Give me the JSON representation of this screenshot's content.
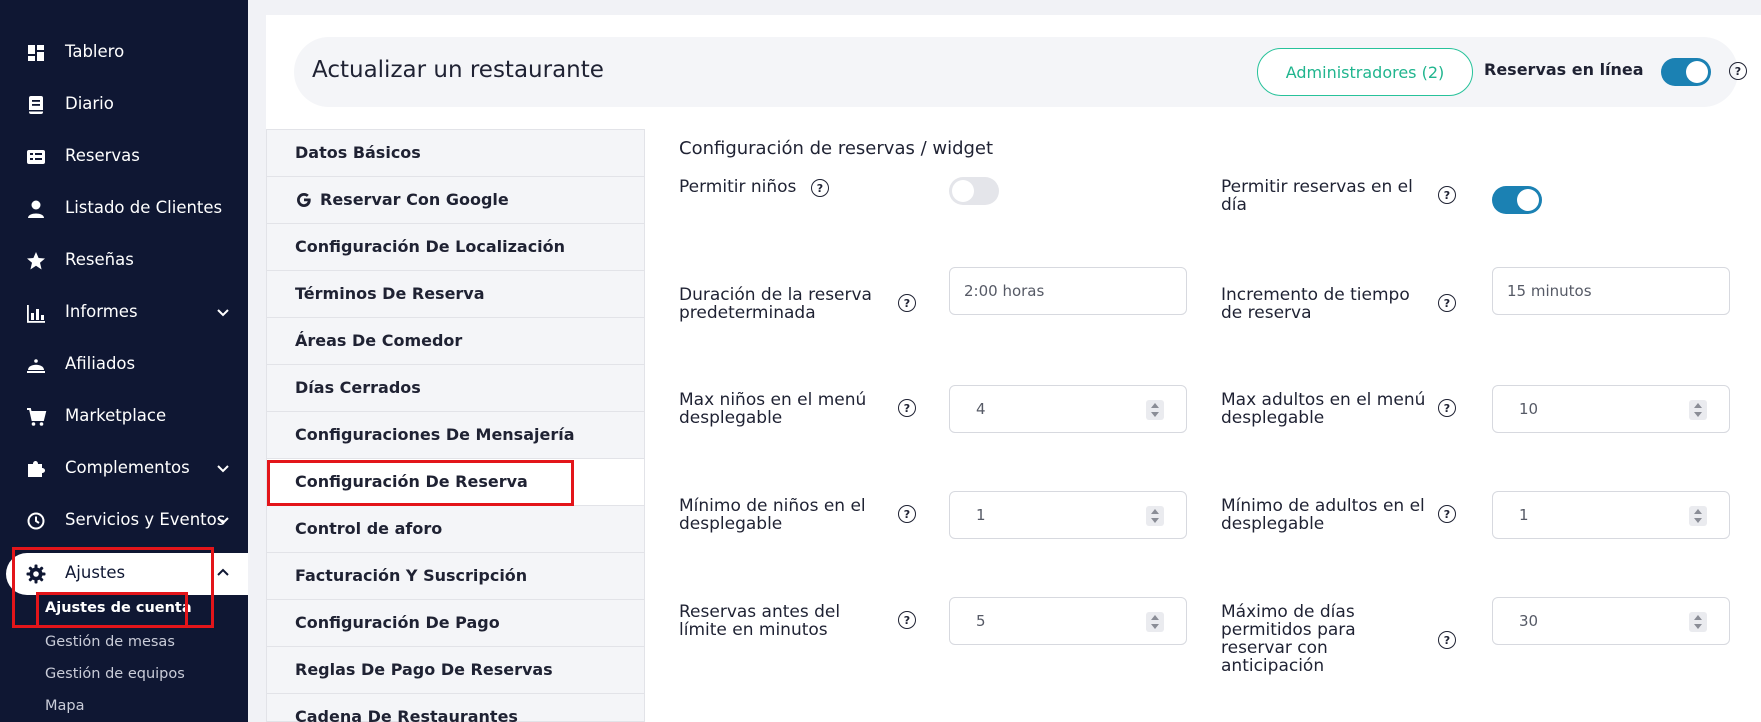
{
  "sidebar": {
    "items": [
      {
        "label": "Tablero",
        "icon": "dashboard-icon"
      },
      {
        "label": "Diario",
        "icon": "book-icon"
      },
      {
        "label": "Reservas",
        "icon": "reservations-icon"
      },
      {
        "label": "Listado de Clientes",
        "icon": "user-icon"
      },
      {
        "label": "Reseñas",
        "icon": "star-icon"
      },
      {
        "label": "Informes",
        "icon": "chart-icon"
      },
      {
        "label": "Afiliados",
        "icon": "bell-icon"
      },
      {
        "label": "Marketplace",
        "icon": "cart-icon"
      },
      {
        "label": "Complementos",
        "icon": "puzzle-icon"
      },
      {
        "label": "Servicios y Eventos",
        "icon": "clock-icon"
      }
    ],
    "active": {
      "label": "Ajustes",
      "icon": "gear-icon"
    },
    "subitems": [
      "Ajustes de cuenta",
      "Gestión de mesas",
      "Gestión de equipos",
      "Mapa"
    ]
  },
  "header": {
    "title": "Actualizar un restaurante",
    "admins_button": "Administradores (2)",
    "online_label": "Reservas en línea",
    "online_enabled": true
  },
  "settings_menu": [
    "Datos Básicos",
    "Reservar Con Google",
    "Configuración De Localización",
    "Términos De Reserva",
    "Áreas De Comedor",
    "Días Cerrados",
    "Configuraciones De Mensajería",
    "Configuración De Reserva",
    "Control de aforo",
    "Facturación Y Suscripción",
    "Configuración De Pago",
    "Reglas De Pago De Reservas",
    "Cadena De Restaurantes"
  ],
  "content": {
    "section_title": "Configuración de reservas / widget",
    "allow_children": {
      "label": "Permitir niños",
      "enabled": false
    },
    "allow_same_day": {
      "label": "Permitir reservas en el día",
      "enabled": true
    },
    "default_duration": {
      "label": "Duración de la reserva predeterminada",
      "value": "2:00 horas"
    },
    "time_increment": {
      "label": "Incremento de tiempo de reserva",
      "value": "15 minutos"
    },
    "max_children": {
      "label": "Max niños en el menú desplegable",
      "value": "4"
    },
    "max_adults": {
      "label": "Max adultos en el menú desplegable",
      "value": "10"
    },
    "min_children": {
      "label": "Mínimo de niños en el desplegable",
      "value": "1"
    },
    "min_adults": {
      "label": "Mínimo de adultos en el desplegable",
      "value": "1"
    },
    "reservations_before_limit": {
      "label": "Reservas antes del límite en minutos",
      "value": "5"
    },
    "max_days_advance": {
      "label": "Máximo de días permitidos para reservar con anticipación",
      "value": "30"
    }
  },
  "help_symbol": "?",
  "colors": {
    "sidebar": "#0f1733",
    "accent": "#1b81b3",
    "admin_btn": "#27c29a",
    "highlight": "#e3151a"
  }
}
